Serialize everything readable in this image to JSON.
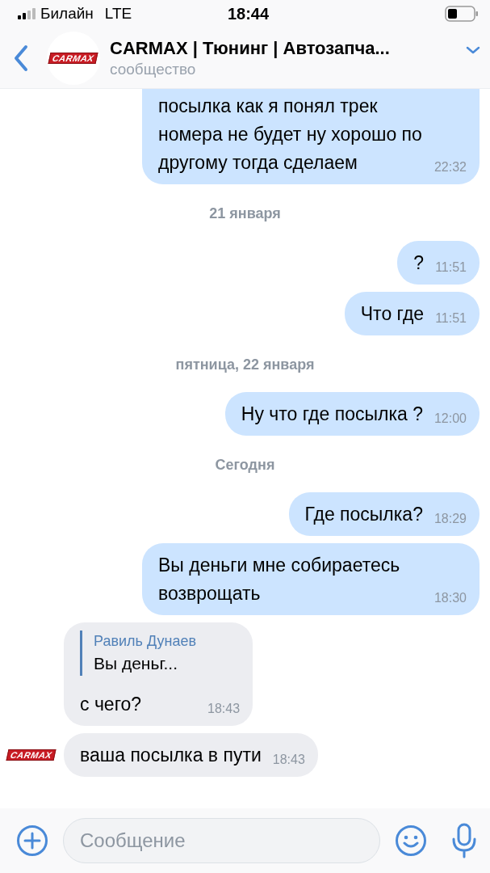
{
  "status_bar": {
    "carrier": "Билайн",
    "network": "LTE",
    "time": "18:44"
  },
  "header": {
    "logo": "CARMAX",
    "title": "CARMAX | Тюнинг | Автозапча...",
    "subtitle": "сообщество"
  },
  "messages": [
    {
      "kind": "outgoing",
      "text": "посылка как я понял трек номера не будет ну хорошо по другому тогда сделаем",
      "time": "22:32",
      "cut": true
    },
    {
      "kind": "date",
      "text": "21 января"
    },
    {
      "kind": "outgoing",
      "text": "?",
      "time": "11:51"
    },
    {
      "kind": "outgoing",
      "text": "Что где",
      "time": "11:51"
    },
    {
      "kind": "date",
      "text": "пятница, 22 января"
    },
    {
      "kind": "outgoing",
      "text": "Ну что где посылка ?",
      "time": "12:00"
    },
    {
      "kind": "date",
      "text": "Сегодня"
    },
    {
      "kind": "outgoing",
      "text": "Где посылка?",
      "time": "18:29"
    },
    {
      "kind": "outgoing",
      "text": "Вы деньги мне собираетесь возврощать",
      "time": "18:30"
    },
    {
      "kind": "incoming",
      "reply": {
        "author": "Равиль Дунаев",
        "text": "Вы деньг..."
      },
      "text": "с чего?",
      "time": "18:43"
    },
    {
      "kind": "incoming",
      "text": "ваша посылка в пути",
      "time": "18:43",
      "logo": "CARMAX"
    }
  ],
  "composer": {
    "placeholder": "Сообщение"
  }
}
